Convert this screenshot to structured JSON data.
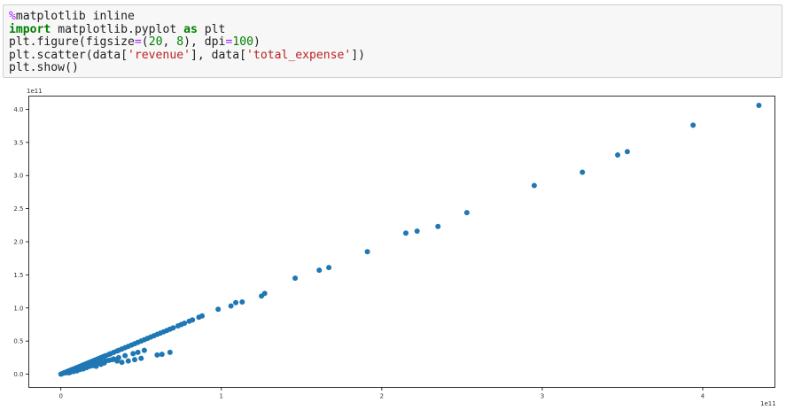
{
  "code_cell": {
    "lines": [
      {
        "tokens": [
          {
            "t": "%",
            "c": "mg"
          },
          {
            "t": "matplotlib inline",
            "c": ""
          }
        ]
      },
      {
        "tokens": [
          {
            "t": "import",
            "c": "kw"
          },
          {
            "t": " matplotlib.pyplot ",
            "c": ""
          },
          {
            "t": "as",
            "c": "kw"
          },
          {
            "t": " plt",
            "c": ""
          }
        ]
      },
      {
        "tokens": [
          {
            "t": "plt.figure(figsize",
            "c": ""
          },
          {
            "t": "=",
            "c": "op"
          },
          {
            "t": "(",
            "c": ""
          },
          {
            "t": "20",
            "c": "nu"
          },
          {
            "t": ", ",
            "c": ""
          },
          {
            "t": "8",
            "c": "nu"
          },
          {
            "t": "), dpi",
            "c": ""
          },
          {
            "t": "=",
            "c": "op"
          },
          {
            "t": "100",
            "c": "nu"
          },
          {
            "t": ")",
            "c": ""
          }
        ]
      },
      {
        "tokens": [
          {
            "t": "plt.scatter(data[",
            "c": ""
          },
          {
            "t": "'revenue'",
            "c": "st"
          },
          {
            "t": "], data[",
            "c": ""
          },
          {
            "t": "'total_expense'",
            "c": "st"
          },
          {
            "t": "])",
            "c": ""
          }
        ]
      },
      {
        "tokens": [
          {
            "t": "plt.show()",
            "c": ""
          }
        ]
      }
    ]
  },
  "chart_data": {
    "type": "scatter",
    "title": "",
    "xlabel": "",
    "ylabel": "",
    "x_offset_label": "1e11",
    "y_offset_label": "1e11",
    "xlim": [
      -0.2,
      4.45
    ],
    "ylim": [
      -0.2,
      4.2
    ],
    "xticks": [
      0,
      1,
      2,
      3,
      4
    ],
    "xtick_labels": [
      "0",
      "1",
      "2",
      "3",
      "4"
    ],
    "yticks": [
      0,
      0.5,
      1.0,
      1.5,
      2.0,
      2.5,
      3.0,
      3.5,
      4.0
    ],
    "ytick_labels": [
      "0.0",
      "0.5",
      "1.0",
      "1.5",
      "2.0",
      "2.5",
      "3.0",
      "3.5",
      "4.0"
    ],
    "grid": false,
    "marker_color": "#1f77b4",
    "points": {
      "x": [
        0.0,
        0.01,
        0.02,
        0.03,
        0.04,
        0.05,
        0.06,
        0.07,
        0.08,
        0.09,
        0.1,
        0.11,
        0.12,
        0.13,
        0.14,
        0.15,
        0.16,
        0.17,
        0.18,
        0.19,
        0.2,
        0.21,
        0.22,
        0.23,
        0.24,
        0.25,
        0.26,
        0.27,
        0.28,
        0.3,
        0.31,
        0.33,
        0.35,
        0.36,
        0.38,
        0.4,
        0.42,
        0.44,
        0.46,
        0.48,
        0.5,
        0.52,
        0.54,
        0.56,
        0.58,
        0.6,
        0.62,
        0.64,
        0.66,
        0.68,
        0.7,
        0.73,
        0.75,
        0.77,
        0.8,
        0.82,
        0.86,
        0.88,
        0.98,
        1.06,
        1.09,
        1.13,
        1.25,
        1.27,
        1.46,
        1.61,
        1.67,
        1.91,
        2.15,
        2.22,
        2.35,
        2.53,
        2.95,
        3.25,
        3.47,
        3.53,
        3.94,
        4.35,
        0.05,
        0.08,
        0.1,
        0.12,
        0.14,
        0.16,
        0.18,
        0.2,
        0.22,
        0.24,
        0.26,
        0.3,
        0.33,
        0.36,
        0.4,
        0.45,
        0.48,
        0.52,
        0.6,
        0.63,
        0.68,
        0.04,
        0.07,
        0.09,
        0.11,
        0.13,
        0.15,
        0.17,
        0.19,
        0.21,
        0.23,
        0.28,
        0.32,
        0.06,
        0.14,
        0.18,
        0.27,
        0.03,
        0.12,
        0.16,
        0.2,
        0.22,
        0.25,
        0.35,
        0.38,
        0.42,
        0.46,
        0.5
      ],
      "y": [
        0.0,
        0.01,
        0.02,
        0.03,
        0.04,
        0.05,
        0.06,
        0.07,
        0.08,
        0.09,
        0.1,
        0.11,
        0.12,
        0.13,
        0.14,
        0.15,
        0.16,
        0.17,
        0.18,
        0.19,
        0.2,
        0.21,
        0.22,
        0.23,
        0.24,
        0.25,
        0.26,
        0.27,
        0.28,
        0.3,
        0.31,
        0.33,
        0.35,
        0.36,
        0.38,
        0.4,
        0.42,
        0.44,
        0.46,
        0.48,
        0.5,
        0.52,
        0.54,
        0.56,
        0.58,
        0.6,
        0.62,
        0.64,
        0.66,
        0.68,
        0.7,
        0.73,
        0.75,
        0.77,
        0.8,
        0.82,
        0.86,
        0.88,
        0.98,
        1.03,
        1.08,
        1.09,
        1.18,
        1.22,
        1.45,
        1.57,
        1.61,
        1.85,
        2.13,
        2.16,
        2.23,
        2.44,
        2.85,
        3.05,
        3.31,
        3.36,
        3.76,
        4.06,
        0.02,
        0.04,
        0.05,
        0.07,
        0.08,
        0.1,
        0.12,
        0.13,
        0.15,
        0.17,
        0.18,
        0.21,
        0.23,
        0.25,
        0.28,
        0.31,
        0.33,
        0.36,
        0.29,
        0.3,
        0.33,
        0.03,
        0.05,
        0.06,
        0.08,
        0.09,
        0.11,
        0.12,
        0.14,
        0.16,
        0.18,
        0.2,
        0.22,
        0.03,
        0.1,
        0.13,
        0.17,
        0.02,
        0.08,
        0.11,
        0.14,
        0.12,
        0.15,
        0.2,
        0.18,
        0.2,
        0.22,
        0.24
      ]
    }
  }
}
